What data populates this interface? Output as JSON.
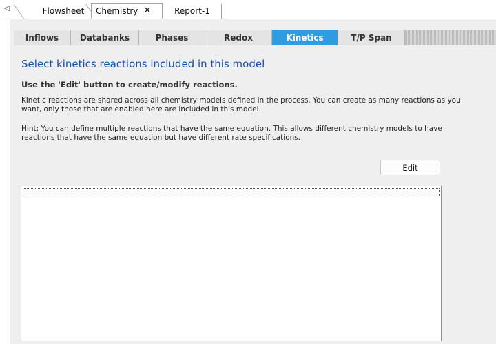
{
  "doc_tabs": {
    "scroll_left_glyph": "◁",
    "items": [
      {
        "label": "Flowsheet"
      },
      {
        "label": "Chemistry",
        "close_glyph": "✕",
        "active": true
      },
      {
        "label": "Report-1"
      }
    ]
  },
  "inner_tabs": [
    {
      "label": "Inflows"
    },
    {
      "label": "Databanks"
    },
    {
      "label": "Phases"
    },
    {
      "label": "Redox"
    },
    {
      "label": "Kinetics",
      "active": true
    },
    {
      "label": "T/P Span"
    }
  ],
  "content": {
    "heading": "Select kinetics reactions included in this model",
    "subheading": "Use the 'Edit' button to create/modify reactions.",
    "paragraph1": "Kinetic reactions are shared across all chemistry models defined in the process. You can create as many reactions as you want, only those that are enabled here are included in this model.",
    "paragraph2": "Hint: You can define multiple reactions that have the same equation. This allows different chemistry models to have reactions that have the same equation but have different rate specifications.",
    "edit_button": "Edit"
  },
  "colors": {
    "active_tab": "#2f9be0",
    "heading": "#1a4fa0",
    "panel_bg": "#efefef"
  }
}
